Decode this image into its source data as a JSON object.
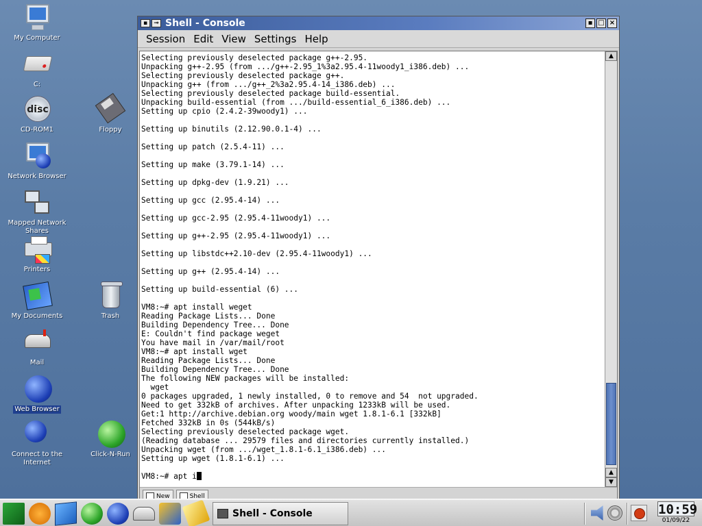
{
  "desktop": {
    "icons": [
      {
        "label": "My Computer"
      },
      {
        "label": "C:"
      },
      {
        "label": "CD-ROM1",
        "overlay": "disc"
      },
      {
        "label": "Floppy"
      },
      {
        "label": "Network Browser"
      },
      {
        "label": "Mapped Network Shares"
      },
      {
        "label": "Printers"
      },
      {
        "label": "My Documents"
      },
      {
        "label": "Trash"
      },
      {
        "label": "Mail"
      },
      {
        "label": "Web Browser"
      },
      {
        "label": "Connect to the Internet"
      },
      {
        "label": "Click-N-Run"
      }
    ]
  },
  "window": {
    "title": "Shell - Console",
    "menu": [
      "Session",
      "Edit",
      "View",
      "Settings",
      "Help"
    ],
    "controls": {
      "minimize": "▪",
      "maximize": "□",
      "close": "×"
    },
    "terminal_lines": [
      "Selecting previously deselected package g++-2.95.",
      "Unpacking g++-2.95 (from .../g++-2.95_1%3a2.95.4-11woody1_i386.deb) ...",
      "Selecting previously deselected package g++.",
      "Unpacking g++ (from .../g++_2%3a2.95.4-14_i386.deb) ...",
      "Selecting previously deselected package build-essential.",
      "Unpacking build-essential (from .../build-essential_6_i386.deb) ...",
      "Setting up cpio (2.4.2-39woody1) ...",
      "",
      "Setting up binutils (2.12.90.0.1-4) ...",
      "",
      "Setting up patch (2.5.4-11) ...",
      "",
      "Setting up make (3.79.1-14) ...",
      "",
      "Setting up dpkg-dev (1.9.21) ...",
      "",
      "Setting up gcc (2.95.4-14) ...",
      "",
      "Setting up gcc-2.95 (2.95.4-11woody1) ...",
      "",
      "Setting up g++-2.95 (2.95.4-11woody1) ...",
      "",
      "Setting up libstdc++2.10-dev (2.95.4-11woody1) ...",
      "",
      "Setting up g++ (2.95.4-14) ...",
      "",
      "Setting up build-essential (6) ...",
      "",
      "VM8:~# apt install weget",
      "Reading Package Lists... Done",
      "Building Dependency Tree... Done",
      "E: Couldn't find package weget",
      "You have mail in /var/mail/root",
      "VM8:~# apt install wget",
      "Reading Package Lists... Done",
      "Building Dependency Tree... Done",
      "The following NEW packages will be installed:",
      "  wget",
      "0 packages upgraded, 1 newly installed, 0 to remove and 54  not upgraded.",
      "Need to get 332kB of archives. After unpacking 1233kB will be used.",
      "Get:1 http://archive.debian.org woody/main wget 1.8.1-6.1 [332kB]",
      "Fetched 332kB in 0s (544kB/s)",
      "Selecting previously deselected package wget.",
      "(Reading database ... 29579 files and directories currently installed.)",
      "Unpacking wget (from .../wget_1.8.1-6.1_i386.deb) ...",
      "Setting up wget (1.8.1-6.1) ...",
      ""
    ],
    "prompt_line": "VM8:~# apt i",
    "tabs": [
      {
        "label": "New"
      },
      {
        "label": "Shell"
      }
    ]
  },
  "taskbar": {
    "launchers": [
      "k-menu-icon",
      "lifebuoy-icon",
      "package-icon",
      "click-n-run-icon",
      "web-browser-icon",
      "mail-icon",
      "runner-icon",
      "pen-icon"
    ],
    "task_button": "Shell - Console",
    "clock_time": "10:59",
    "clock_date": "01/09/22"
  }
}
